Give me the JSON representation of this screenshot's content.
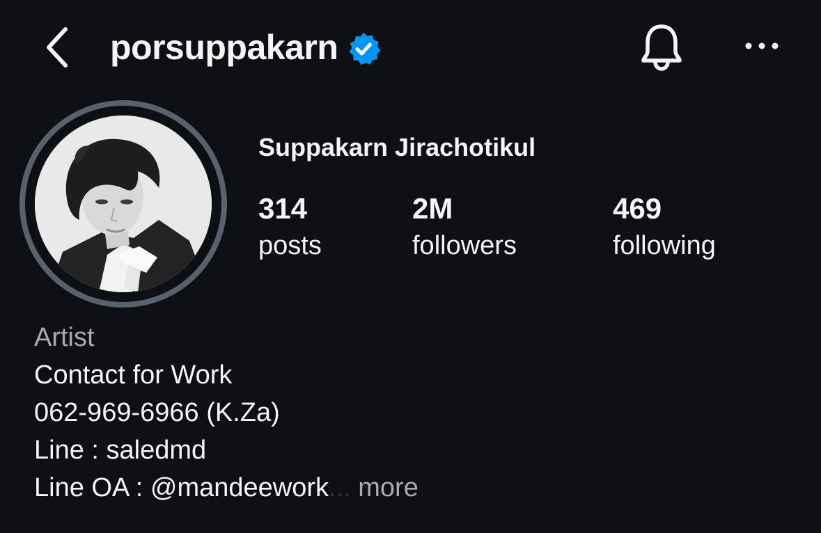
{
  "header": {
    "username": "porsuppakarn",
    "back_icon": "chevron-left-icon",
    "verified_icon": "verified-badge-icon",
    "bell_icon": "bell-icon",
    "more_icon": "more-horizontal-icon"
  },
  "profile": {
    "full_name": "Suppakarn Jirachotikul",
    "stats": [
      {
        "count": "314",
        "label": "posts"
      },
      {
        "count": "2M",
        "label": "followers"
      },
      {
        "count": "469",
        "label": "following"
      }
    ]
  },
  "bio": {
    "category": "Artist",
    "lines": [
      "Contact for Work",
      "062-969-6966 (K.Za)",
      "Line : saledmd"
    ],
    "truncated_line": "Line OA : @mandeework",
    "ellipsis": "...",
    "more_label": "more"
  },
  "colors": {
    "background": "#0c1014",
    "text": "#f5f5f5",
    "muted": "#a8abb2",
    "verified": "#0095f6",
    "avatar_ring": "#59616d"
  }
}
